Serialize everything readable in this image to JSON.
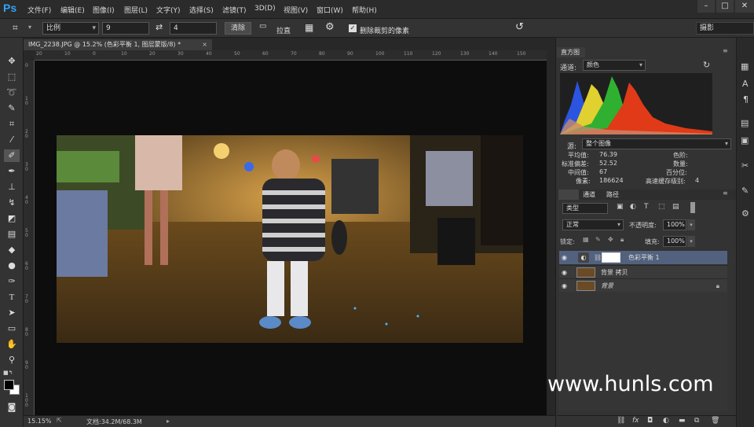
{
  "app": {
    "logo": "Ps"
  },
  "menu": [
    "文件(F)",
    "编辑(E)",
    "图像(I)",
    "图层(L)",
    "文字(Y)",
    "选择(S)",
    "滤镜(T)",
    "3D(D)",
    "视图(V)",
    "窗口(W)",
    "帮助(H)"
  ],
  "options": {
    "ratio_label": "比例",
    "width_value": "9",
    "height_value": "4",
    "clear_button": "清除",
    "straighten_label": "拉直",
    "delete_cropped_label": "删除裁剪的像素",
    "workspace": "摄影"
  },
  "document": {
    "tab_title": "IMG_2238.JPG @ 15.2% (色彩平衡 1, 图层蒙版/8) *",
    "ruler_h": [
      "20",
      "10",
      "0",
      "10",
      "20",
      "30",
      "40",
      "50",
      "60",
      "70",
      "80",
      "90",
      "100",
      "110",
      "120",
      "130",
      "140",
      "150"
    ],
    "ruler_v": [
      "0",
      "1 0",
      "2 0",
      "3 0",
      "4 0",
      "5 0",
      "6 0",
      "7 0",
      "8 0",
      "9 0",
      "1 0 0"
    ]
  },
  "status": {
    "zoom": "15.15%",
    "doc_info": "文档:34.2M/68.3M"
  },
  "histogram": {
    "tab": "直方图",
    "channel_label": "通道:",
    "channel_value": "颜色",
    "source_label": "源:",
    "source_value": "整个图像",
    "mean_label": "平均值:",
    "mean_value": "76.39",
    "std_label": "标准偏差:",
    "std_value": "52.52",
    "median_label": "中间值:",
    "median_value": "67",
    "pixels_label": "像素:",
    "pixels_value": "186624",
    "level_label": "色阶:",
    "count_label": "数量:",
    "percent_label": "百分位:",
    "cache_label": "高速缓存级别:",
    "cache_value": "4"
  },
  "layers": {
    "tabs": [
      "通道",
      "路径"
    ],
    "kind_value": "类型",
    "blend_mode": "正常",
    "opacity_label": "不透明度:",
    "opacity_value": "100%",
    "lock_label": "锁定:",
    "fill_label": "填充:",
    "fill_value": "100%",
    "items": [
      {
        "name": "色彩平衡 1"
      },
      {
        "name": "背景 拷贝"
      },
      {
        "name": "背景"
      }
    ],
    "footer_fx": "fx"
  },
  "watermark": "www.hunls.com",
  "colors": {
    "accent": "#2fa3f6",
    "selected_layer": "#52627e"
  }
}
